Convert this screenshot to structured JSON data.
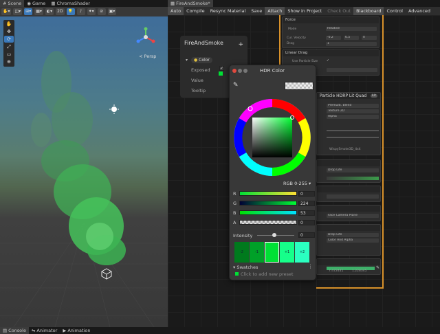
{
  "scene_tabs": {
    "scene": "Scene",
    "game": "Game",
    "chroma": "ChromaShader"
  },
  "scene_toolbar": {
    "mode_2d": "2D",
    "persp": "Persp"
  },
  "sg_tabs": {
    "file": "FireAndSmoke*"
  },
  "sg_toolbar": {
    "auto": "Auto",
    "compile": "Compile",
    "resync": "Resync Material",
    "save": "Save",
    "attach": "Attach",
    "show_in_project": "Show in Project",
    "check_out": "Check Out",
    "blackboard": "Blackboard",
    "control": "Control",
    "advanced": "Advanced"
  },
  "blackboard": {
    "title": "FireAndSmoke",
    "add": "+",
    "property_pill": "Color",
    "rows": {
      "exposed": "Exposed",
      "value": "Value",
      "tooltip": "Tooltip"
    }
  },
  "nodes": {
    "force": {
      "title": "Force",
      "mode_label": "Mode",
      "mode_value": "Relative",
      "vel_label": "Cur. Velocity",
      "vel": [
        "-0.2",
        "0.5",
        "0"
      ],
      "drag_label": "Drag",
      "drag": "1"
    },
    "linear_drag": {
      "title": "Linear Drag",
      "use_size": "Use Particle Size"
    },
    "quad": {
      "title": "Particle HDRP Lit Quad",
      "badge": "Lit",
      "blend": "Premulti. Blend",
      "texture": "Texture 2D",
      "alpha": "Alpha",
      "texture_name": "WispySmoke3D_4x4",
      "row_a": "Drop Life",
      "facing": "Face Camera Plane",
      "row_b": "Drop Life",
      "row_c": "Color And Alpha"
    },
    "bottom_values": [
      "7.472441",
      "1.228345"
    ]
  },
  "hdr_picker": {
    "title": "HDR Color",
    "mode": "RGB 0-255",
    "channels": [
      {
        "label": "R",
        "value": "0"
      },
      {
        "label": "G",
        "value": "224"
      },
      {
        "label": "B",
        "value": "53"
      },
      {
        "label": "A",
        "value": "0"
      }
    ],
    "intensity_label": "Intensity",
    "intensity_value": "0",
    "swatch_labels": [
      "-2",
      "-1",
      "",
      "+1",
      "+2"
    ],
    "swatches_title": "Swatches",
    "add_preset": "Click to add new preset"
  },
  "bottom_tabs": {
    "console": "Console",
    "animator": "Animator",
    "animation": "Animation"
  },
  "colors": {
    "accent": "#3a79bb",
    "orange": "#d8912a",
    "picker_green": "#00e035"
  }
}
